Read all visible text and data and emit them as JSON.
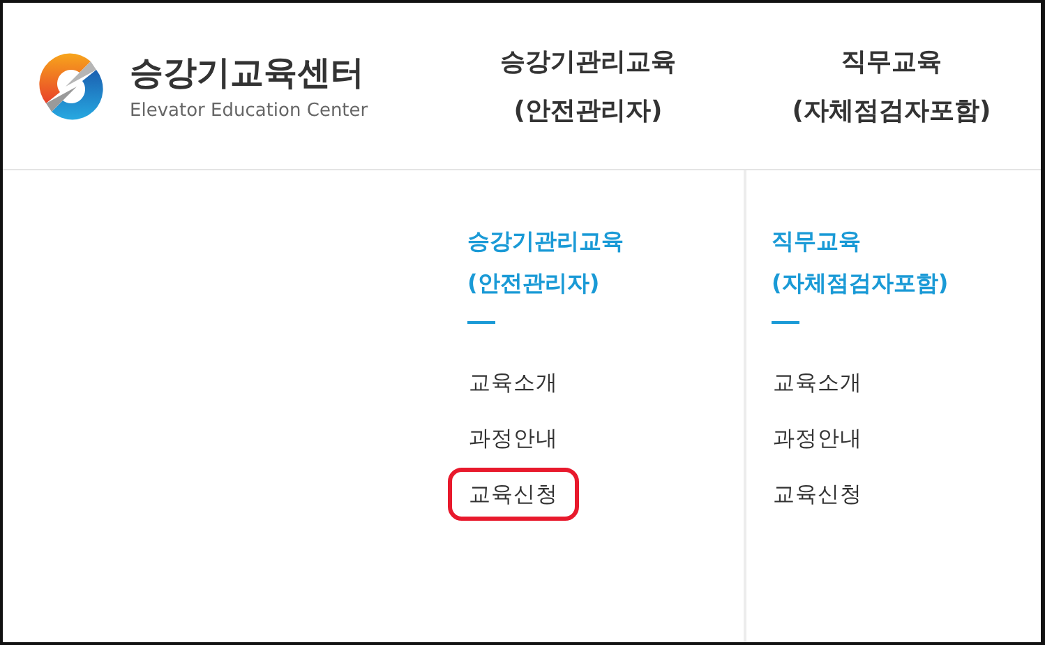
{
  "logo": {
    "title": "승강기교육센터",
    "subtitle": "Elevator Education Center"
  },
  "nav": [
    {
      "label": "승강기관리교육\n(안전관리자)"
    },
    {
      "label": "직무교육\n(자체점검자포함)"
    }
  ],
  "dropdown": [
    {
      "heading": "승강기관리교육\n(안전관리자)",
      "items": [
        {
          "label": "교육소개",
          "highlighted": false
        },
        {
          "label": "과정안내",
          "highlighted": false
        },
        {
          "label": "교육신청",
          "highlighted": true
        }
      ]
    },
    {
      "heading": "직무교육\n(자체점검자포함)",
      "items": [
        {
          "label": "교육소개",
          "highlighted": false
        },
        {
          "label": "과정안내",
          "highlighted": false
        },
        {
          "label": "교육신청",
          "highlighted": false
        }
      ]
    }
  ]
}
